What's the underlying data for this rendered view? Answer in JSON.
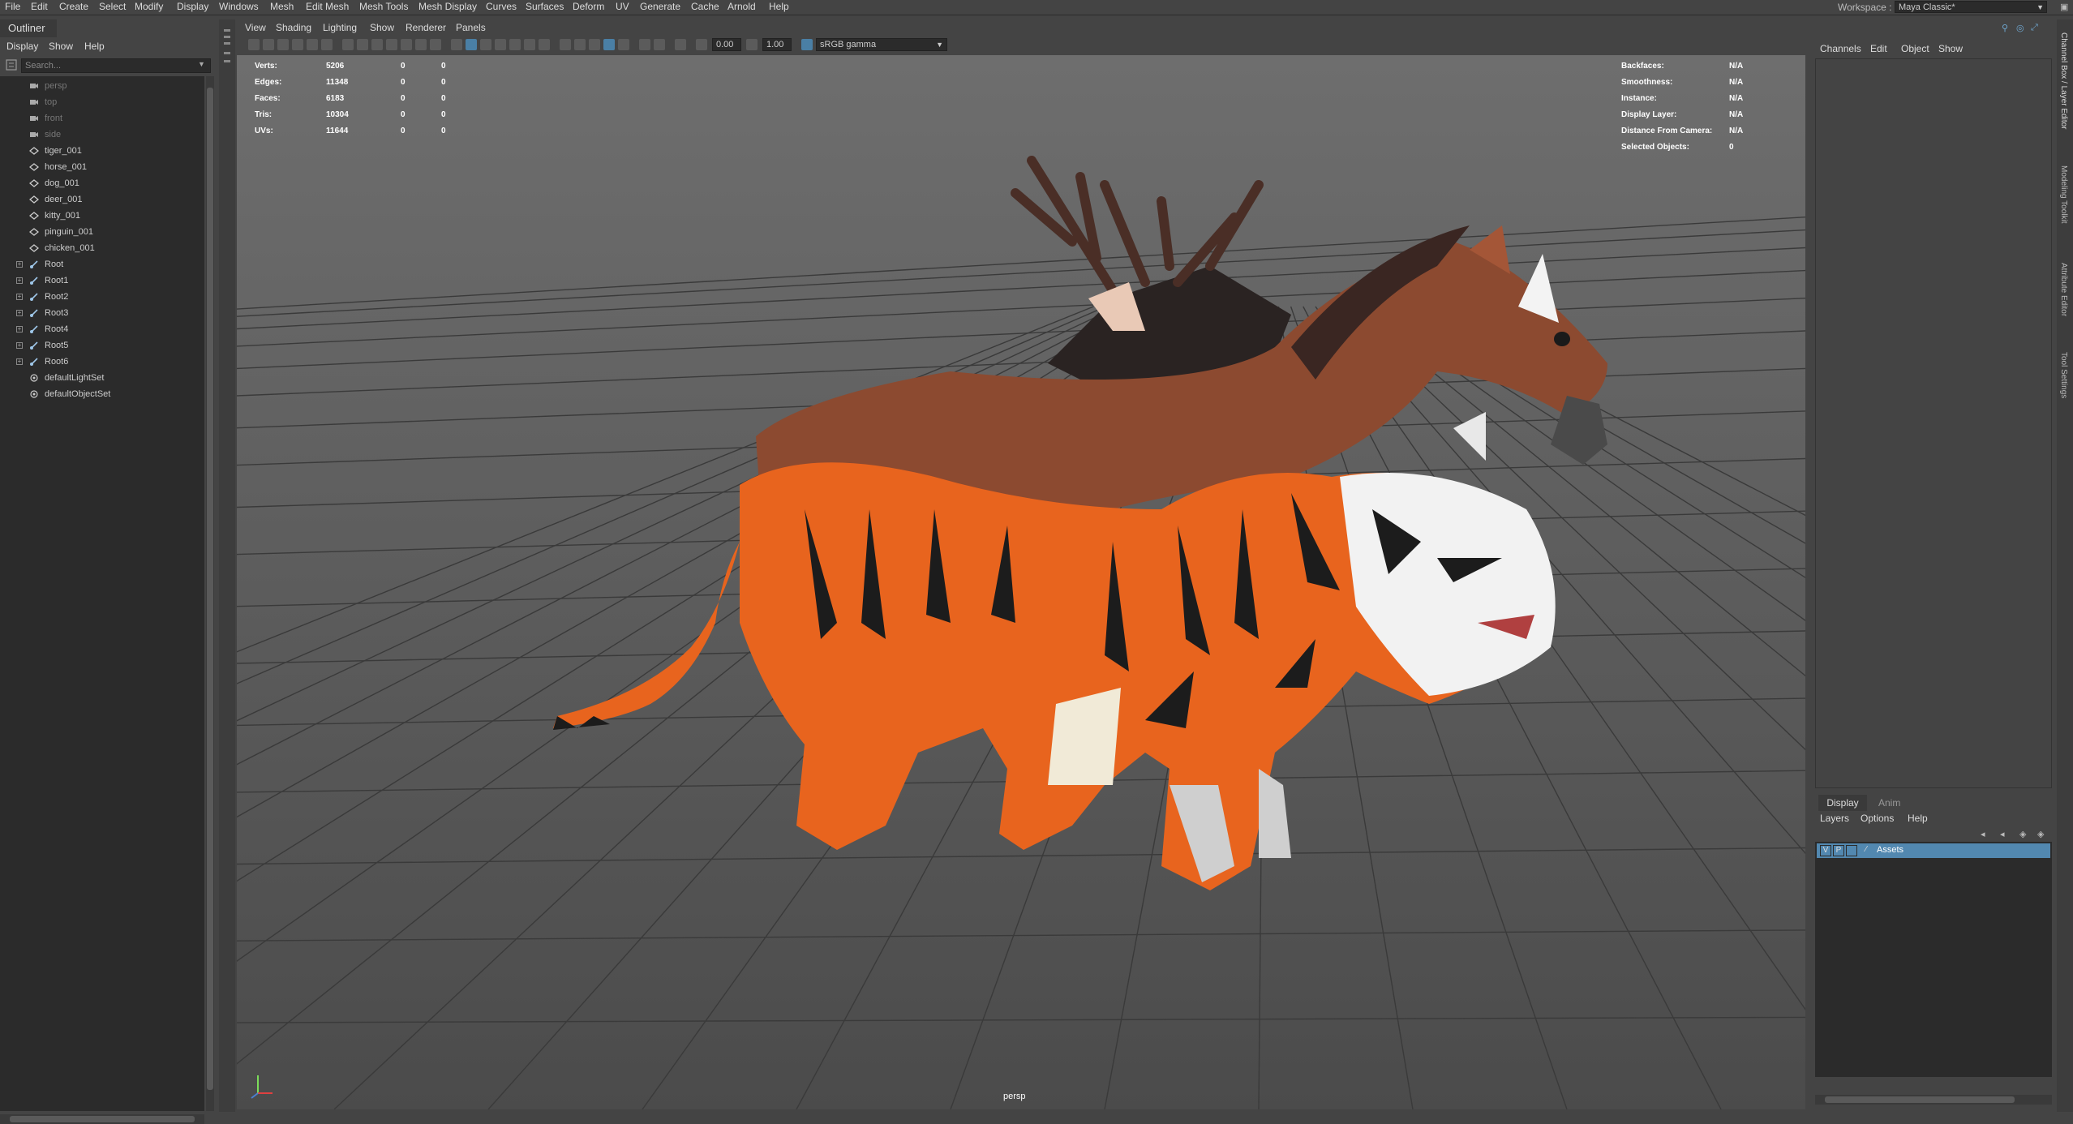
{
  "menubar": {
    "items": [
      "File",
      "Edit",
      "Create",
      "Select",
      "Modify",
      "Display",
      "Windows",
      "Mesh",
      "Edit Mesh",
      "Mesh Tools",
      "Mesh Display",
      "Curves",
      "Surfaces",
      "Deform",
      "UV",
      "Generate",
      "Cache",
      "Arnold",
      "Help"
    ],
    "workspace_label": "Workspace :",
    "workspace_value": "Maya Classic*"
  },
  "outliner": {
    "title": "Outliner",
    "menu": [
      "Display",
      "Show",
      "Help"
    ],
    "search_placeholder": "Search...",
    "items": [
      {
        "label": "persp",
        "icon": "camera-icon",
        "dim": true,
        "expand": false
      },
      {
        "label": "top",
        "icon": "camera-icon",
        "dim": true,
        "expand": false
      },
      {
        "label": "front",
        "icon": "camera-icon",
        "dim": true,
        "expand": false
      },
      {
        "label": "side",
        "icon": "camera-icon",
        "dim": true,
        "expand": false
      },
      {
        "label": "tiger_001",
        "icon": "mesh-icon",
        "dim": false,
        "expand": false
      },
      {
        "label": "horse_001",
        "icon": "mesh-icon",
        "dim": false,
        "expand": false
      },
      {
        "label": "dog_001",
        "icon": "mesh-icon",
        "dim": false,
        "expand": false
      },
      {
        "label": "deer_001",
        "icon": "mesh-icon",
        "dim": false,
        "expand": false
      },
      {
        "label": "kitty_001",
        "icon": "mesh-icon",
        "dim": false,
        "expand": false
      },
      {
        "label": "pinguin_001",
        "icon": "mesh-icon",
        "dim": false,
        "expand": false
      },
      {
        "label": "chicken_001",
        "icon": "mesh-icon",
        "dim": false,
        "expand": false
      },
      {
        "label": "Root",
        "icon": "joint-icon",
        "dim": false,
        "expand": true
      },
      {
        "label": "Root1",
        "icon": "joint-icon",
        "dim": false,
        "expand": true
      },
      {
        "label": "Root2",
        "icon": "joint-icon",
        "dim": false,
        "expand": true
      },
      {
        "label": "Root3",
        "icon": "joint-icon",
        "dim": false,
        "expand": true
      },
      {
        "label": "Root4",
        "icon": "joint-icon",
        "dim": false,
        "expand": true
      },
      {
        "label": "Root5",
        "icon": "joint-icon",
        "dim": false,
        "expand": true
      },
      {
        "label": "Root6",
        "icon": "joint-icon",
        "dim": false,
        "expand": true
      },
      {
        "label": "defaultLightSet",
        "icon": "set-icon",
        "dim": false,
        "expand": false
      },
      {
        "label": "defaultObjectSet",
        "icon": "set-icon",
        "dim": false,
        "expand": false
      }
    ]
  },
  "viewport": {
    "menu": [
      "View",
      "Shading",
      "Lighting",
      "Show",
      "Renderer",
      "Panels"
    ],
    "exposure": "0.00",
    "gamma": "1.00",
    "color_space": "sRGB gamma",
    "camera_label": "persp",
    "hud_left": [
      {
        "label": "Verts:",
        "v1": "5206",
        "v2": "0",
        "v3": "0"
      },
      {
        "label": "Edges:",
        "v1": "11348",
        "v2": "0",
        "v3": "0"
      },
      {
        "label": "Faces:",
        "v1": "6183",
        "v2": "0",
        "v3": "0"
      },
      {
        "label": "Tris:",
        "v1": "10304",
        "v2": "0",
        "v3": "0"
      },
      {
        "label": "UVs:",
        "v1": "11644",
        "v2": "0",
        "v3": "0"
      }
    ],
    "hud_right": [
      {
        "label": "Backfaces:",
        "value": "N/A"
      },
      {
        "label": "Smoothness:",
        "value": "N/A"
      },
      {
        "label": "Instance:",
        "value": "N/A"
      },
      {
        "label": "Display Layer:",
        "value": "N/A"
      },
      {
        "label": "Distance From Camera:",
        "value": "N/A"
      },
      {
        "label": "Selected Objects:",
        "value": "0"
      }
    ]
  },
  "channel_box": {
    "menu": [
      "Channels",
      "Edit",
      "Object",
      "Show"
    ]
  },
  "right_strip_tabs": [
    "Channel Box / Layer Editor",
    "Modeling Toolkit",
    "Attribute Editor",
    "Tool Settings"
  ],
  "layer_editor": {
    "tabs": [
      "Display",
      "Anim"
    ],
    "menu": [
      "Layers",
      "Options",
      "Help"
    ],
    "layer": {
      "v": "V",
      "p": "P",
      "name": "Assets"
    }
  },
  "colors": {
    "accent": "#5288b0",
    "tiger_orange": "#e8641e",
    "horse_brown": "#8c4a30",
    "antler": "#4a2e26"
  }
}
